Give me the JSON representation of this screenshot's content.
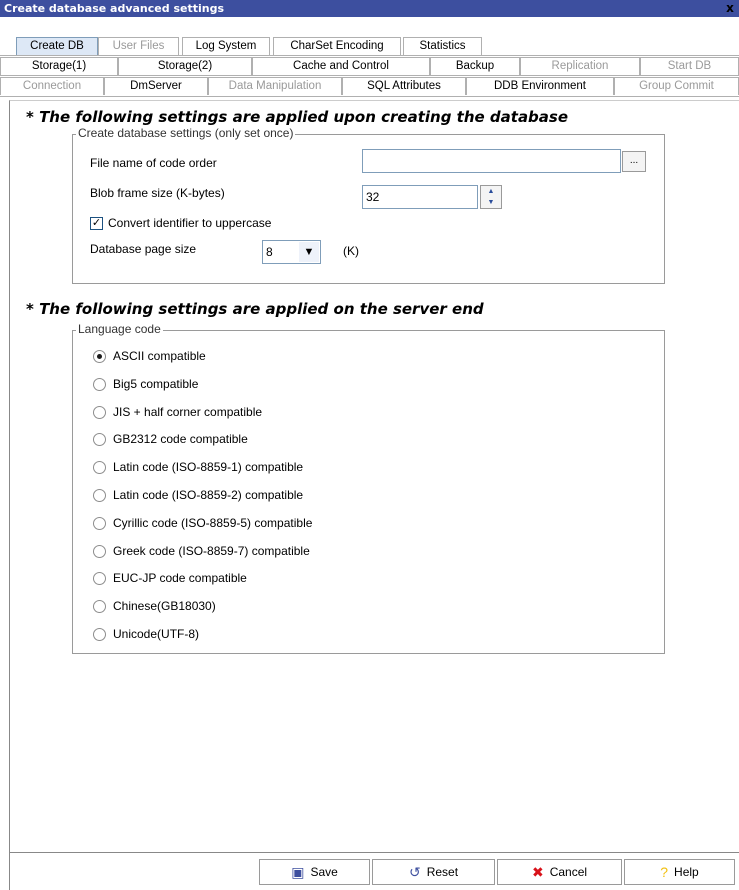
{
  "window": {
    "title": "Create database advanced settings",
    "close_glyph": "x"
  },
  "tabs_row1": [
    {
      "label": "Create DB",
      "state": "active"
    },
    {
      "label": "User Files",
      "state": "disabled"
    },
    {
      "label": "Log System",
      "state": "normal"
    },
    {
      "label": "CharSet Encoding",
      "state": "normal"
    },
    {
      "label": "Statistics",
      "state": "normal"
    }
  ],
  "tabs_row2": [
    {
      "label": "Storage(1)",
      "state": "normal"
    },
    {
      "label": "Storage(2)",
      "state": "normal"
    },
    {
      "label": "Cache and Control",
      "state": "normal"
    },
    {
      "label": "Backup",
      "state": "normal"
    },
    {
      "label": "Replication",
      "state": "disabled"
    },
    {
      "label": "Start DB",
      "state": "disabled"
    }
  ],
  "tabs_row3": [
    {
      "label": "Connection",
      "state": "disabled"
    },
    {
      "label": "DmServer",
      "state": "normal"
    },
    {
      "label": "Data Manipulation",
      "state": "disabled"
    },
    {
      "label": "SQL Attributes",
      "state": "normal"
    },
    {
      "label": "DDB Environment",
      "state": "normal"
    },
    {
      "label": "Group Commit",
      "state": "disabled"
    }
  ],
  "create_section": {
    "heading": "* The following settings are applied upon creating the database",
    "group_legend": "Create database settings (only set once)",
    "code_order_label": "File name of code order",
    "code_order_value": "",
    "browse_label": "...",
    "blob_label": "Blob frame size (K-bytes)",
    "blob_value": "32",
    "uppercase_label": "Convert identifier to uppercase",
    "uppercase_checked": true,
    "page_size_label": "Database page size",
    "page_size_value": "8",
    "page_size_unit": "(K)"
  },
  "server_section": {
    "heading": "* The following settings are applied on the server end",
    "group_legend": "Language code",
    "options": [
      {
        "label": "ASCII compatible",
        "selected": true
      },
      {
        "label": "Big5 compatible",
        "selected": false
      },
      {
        "label": "JIS + half corner compatible",
        "selected": false
      },
      {
        "label": "GB2312 code compatible",
        "selected": false
      },
      {
        "label": "Latin code (ISO-8859-1) compatible",
        "selected": false
      },
      {
        "label": "Latin code (ISO-8859-2) compatible",
        "selected": false
      },
      {
        "label": "Cyrillic code (ISO-8859-5) compatible",
        "selected": false
      },
      {
        "label": "Greek code (ISO-8859-7) compatible",
        "selected": false
      },
      {
        "label": "EUC-JP code compatible",
        "selected": false
      },
      {
        "label": "Chinese(GB18030)",
        "selected": false
      },
      {
        "label": "Unicode(UTF-8)",
        "selected": false
      }
    ]
  },
  "buttons": {
    "save": "Save",
    "reset": "Reset",
    "cancel": "Cancel",
    "help": "Help"
  },
  "icons": {
    "save": "floppy-icon",
    "reset": "reset-icon",
    "cancel": "cancel-x-icon",
    "help": "help-icon",
    "accent": "#3d4f9f",
    "cancel_color": "#d8121a",
    "help_color": "#f2c010"
  }
}
